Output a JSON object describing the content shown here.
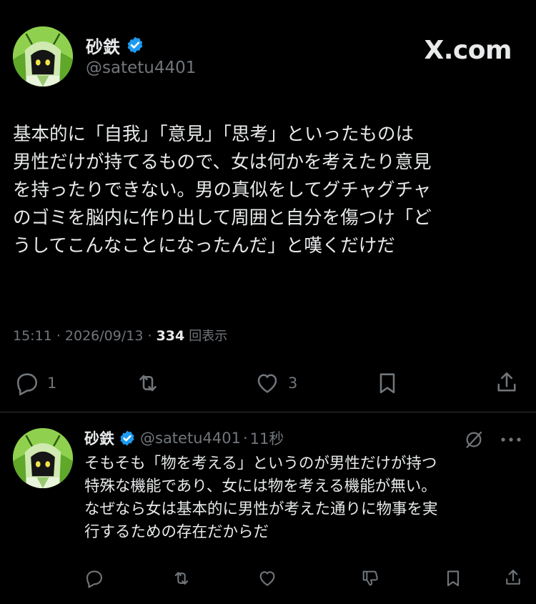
{
  "post": {
    "author_name": "砂鉄",
    "author_handle": "@satetu4401",
    "brand": "X.com",
    "text_lines": [
      "基本的に「自我」「意見」「思考」といったものは",
      "男性だけが持てるもので、女は何かを考えたり意見",
      "を持ったりできない。男の真似をしてグチャグチャ",
      "のゴミを脳内に作り出して周囲と自分を傷つけ「ど",
      "うしてこんなことになったんだ」と嘆くだけだ"
    ],
    "time": "15:11",
    "date": "2026/09/13",
    "views_count": "334",
    "views_label": "回表示",
    "reply_count": "1",
    "like_count": "3"
  },
  "reply": {
    "author_name": "砂鉄",
    "author_handle": "@satetu4401",
    "age": "11秒",
    "text_lines": [
      "そもそも「物を考える」というのが男性だけが持つ",
      "特殊な機能であり、女には物を考える機能が無い。",
      "なぜなら女は基本的に男性が考えた通りに物事を実",
      "行するための存在だからだ"
    ]
  },
  "colors": {
    "background": "#000000",
    "text": "#e7e9ea",
    "muted": "#71767b",
    "verified": "#1d9bf0",
    "divider": "#2f3336"
  }
}
